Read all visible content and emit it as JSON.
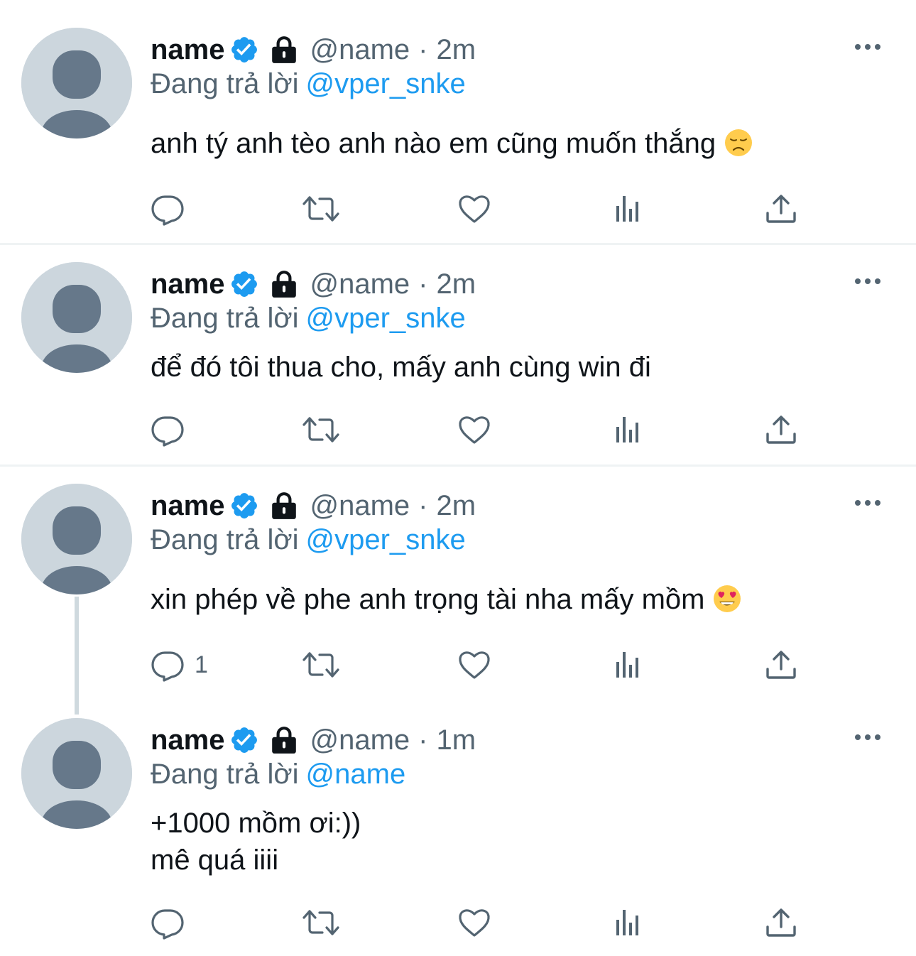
{
  "colors": {
    "text": "#0f1419",
    "secondary": "#536471",
    "accent": "#1d9bf0",
    "avatar_bg": "#ccd6dd",
    "avatar_fg": "#66788a",
    "divider": "#eff3f4"
  },
  "icons": {
    "avatar": "default-profile-icon",
    "verified": "verified-badge-icon",
    "lock": "lock-icon",
    "more": "more-options-icon",
    "reply": "reply-icon",
    "retweet": "retweet-icon",
    "like": "heart-icon",
    "views": "analytics-icon",
    "share": "share-icon"
  },
  "tweets": [
    {
      "name": "name",
      "handle": "@name",
      "separator": "·",
      "time": "2m",
      "reply_prefix": "Đang trả lời",
      "reply_to": "@vper_snke",
      "text": "anh tý anh tèo anh nào em cũng muốn thắng",
      "emoji": "disappointed-face",
      "reply_count": ""
    },
    {
      "name": "name",
      "handle": "@name",
      "separator": "·",
      "time": "2m",
      "reply_prefix": "Đang trả lời",
      "reply_to": "@vper_snke",
      "text": "để đó tôi thua cho, mấy anh cùng win đi",
      "emoji": "",
      "reply_count": ""
    },
    {
      "name": "name",
      "handle": "@name",
      "separator": "·",
      "time": "2m",
      "reply_prefix": "Đang trả lời",
      "reply_to": "@vper_snke",
      "text": "xin phép về phe anh trọng tài nha mấy mồm",
      "emoji": "heart-eyes-face",
      "reply_count": "1"
    },
    {
      "name": "name",
      "handle": "@name",
      "separator": "·",
      "time": "1m",
      "reply_prefix": "Đang trả lời",
      "reply_to": "@name",
      "text_line1": "+1000 mồm ơi:))",
      "text_line2": "mê quá iiii",
      "emoji": "",
      "reply_count": ""
    }
  ]
}
